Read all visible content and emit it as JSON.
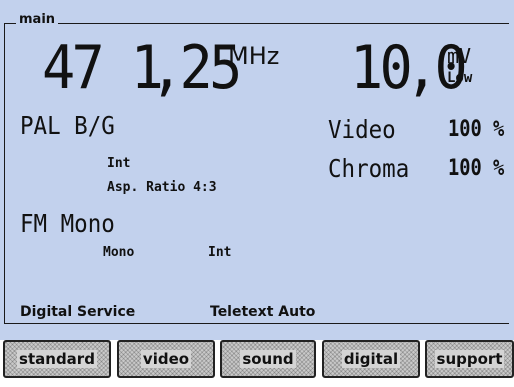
{
  "panel": {
    "title": "main"
  },
  "frequency": {
    "integer": "47 1",
    "decimal": ",25",
    "unit": "MHz"
  },
  "level": {
    "integer": "10",
    "decimal": ",0",
    "unit": "mV",
    "mode": "Low"
  },
  "video_standard": {
    "name": "PAL B/G",
    "source": "Int",
    "aspect": "Asp. Ratio 4:3"
  },
  "modulation": {
    "video_label": "Video",
    "video_value": "100 %",
    "chroma_label": "Chroma",
    "chroma_value": "100 %"
  },
  "audio": {
    "mode": "FM Mono",
    "channel": "Mono",
    "source": "Int"
  },
  "services": {
    "digital": "Digital Service",
    "teletext": "Teletext Auto"
  },
  "softkeys": [
    {
      "label": "standard"
    },
    {
      "label": "video"
    },
    {
      "label": "sound"
    },
    {
      "label": "digital"
    },
    {
      "label": "support"
    }
  ]
}
